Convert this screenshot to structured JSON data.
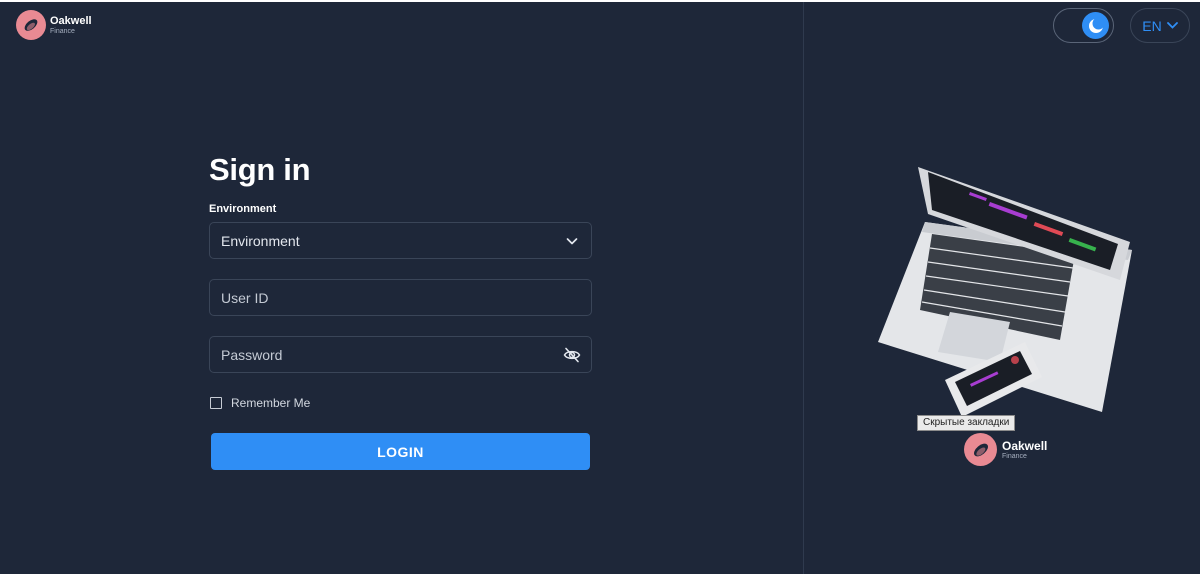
{
  "brand": {
    "name": "Oakwell",
    "subtitle": "Finance",
    "logo_icon": "oakwell-logo-icon",
    "accent": "#e98a93"
  },
  "header": {
    "theme_toggle_icon": "moon-icon",
    "language": "EN",
    "language_icon": "chevron-down-icon"
  },
  "signin": {
    "title": "Sign in",
    "environment_label": "Environment",
    "environment_value": "Environment",
    "user_id_placeholder": "User ID",
    "password_placeholder": "Password",
    "password_toggle_icon": "eye-off-icon",
    "remember_label": "Remember Me",
    "remember_checked": false,
    "login_label": "LOGIN"
  },
  "illustration": {
    "tooltip": "Скрытые закладки",
    "brand_name": "Oakwell",
    "brand_subtitle": "Finance"
  },
  "colors": {
    "background": "#1e2739",
    "primary": "#2f8ef5",
    "border": "#3a4558"
  }
}
